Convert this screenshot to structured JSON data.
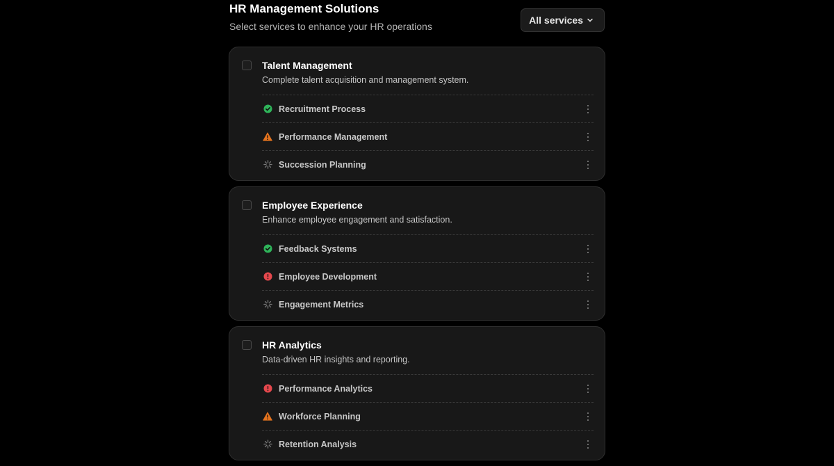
{
  "header": {
    "title": "HR Management Solutions",
    "subtitle": "Select services to enhance your HR operations",
    "filter_label": "All services"
  },
  "status_colors": {
    "complete": "#2fb45a",
    "warning": "#e3731f",
    "error": "#e5484d",
    "pending": "#7a7a7a"
  },
  "cards": [
    {
      "title": "Talent Management",
      "description": "Complete talent acquisition and management system.",
      "items": [
        {
          "label": "Recruitment Process",
          "status": "complete",
          "icon": "check-circle-icon"
        },
        {
          "label": "Performance Management",
          "status": "warning",
          "icon": "warning-triangle-icon"
        },
        {
          "label": "Succession Planning",
          "status": "pending",
          "icon": "loader-icon"
        }
      ]
    },
    {
      "title": "Employee Experience",
      "description": "Enhance employee engagement and satisfaction.",
      "items": [
        {
          "label": "Feedback Systems",
          "status": "complete",
          "icon": "check-circle-icon"
        },
        {
          "label": "Employee Development",
          "status": "error",
          "icon": "alert-circle-icon"
        },
        {
          "label": "Engagement Metrics",
          "status": "pending",
          "icon": "loader-icon"
        }
      ]
    },
    {
      "title": "HR Analytics",
      "description": "Data-driven HR insights and reporting.",
      "items": [
        {
          "label": "Performance Analytics",
          "status": "error",
          "icon": "alert-circle-icon"
        },
        {
          "label": "Workforce Planning",
          "status": "warning",
          "icon": "warning-triangle-icon"
        },
        {
          "label": "Retention Analysis",
          "status": "pending",
          "icon": "loader-icon"
        }
      ]
    }
  ]
}
